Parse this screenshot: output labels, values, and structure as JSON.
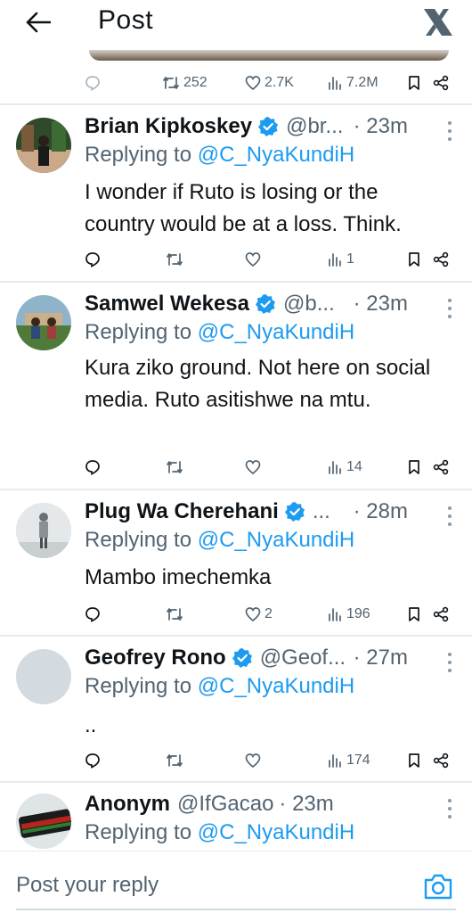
{
  "header": {
    "title": "Post",
    "back_icon": "arrow-left-icon",
    "logo_icon": "x-logo-icon"
  },
  "top_post_actions": {
    "reposts": "252",
    "likes": "2.7K",
    "views": "7.2M"
  },
  "replies": [
    {
      "name": "Brian Kipkoskey",
      "handle": "@br...",
      "time": "· 23m",
      "replying_prefix": "Replying to ",
      "replying_to": "@C_NyaKundiH",
      "text": "I wonder if Ruto is losing or the country would be at a loss. Think.",
      "views": "1",
      "likes": "",
      "reposts": ""
    },
    {
      "name": "Samwel Wekesa",
      "handle": "@b...",
      "time": "· 23m",
      "replying_prefix": "Replying to ",
      "replying_to": "@C_NyaKundiH",
      "text": "Kura ziko ground. Not here on social media. Ruto asitishwe na mtu.",
      "views": "14",
      "likes": "",
      "reposts": ""
    },
    {
      "name": "Plug Wa Cherehani",
      "handle": "...",
      "time": "· 28m",
      "replying_prefix": "Replying to ",
      "replying_to": "@C_NyaKundiH",
      "text": "Mambo imechemka",
      "views": "196",
      "likes": "2",
      "reposts": ""
    },
    {
      "name": "Geofrey Rono",
      "handle": "@Geof...",
      "time": "· 27m",
      "replying_prefix": "Replying to ",
      "replying_to": "@C_NyaKundiH",
      "text": "..",
      "views": "174",
      "likes": "",
      "reposts": ""
    },
    {
      "name": "Anonym",
      "handle": "@IfGacao",
      "time": "· 23m",
      "replying_prefix": "Replying to ",
      "replying_to": "@C_NyaKundiH"
    }
  ],
  "composer": {
    "placeholder": "Post your reply",
    "camera_icon": "camera-icon"
  },
  "colors": {
    "accent": "#1d9bf0",
    "muted": "#536471",
    "text": "#0f1419",
    "divider": "#e6eaed"
  }
}
